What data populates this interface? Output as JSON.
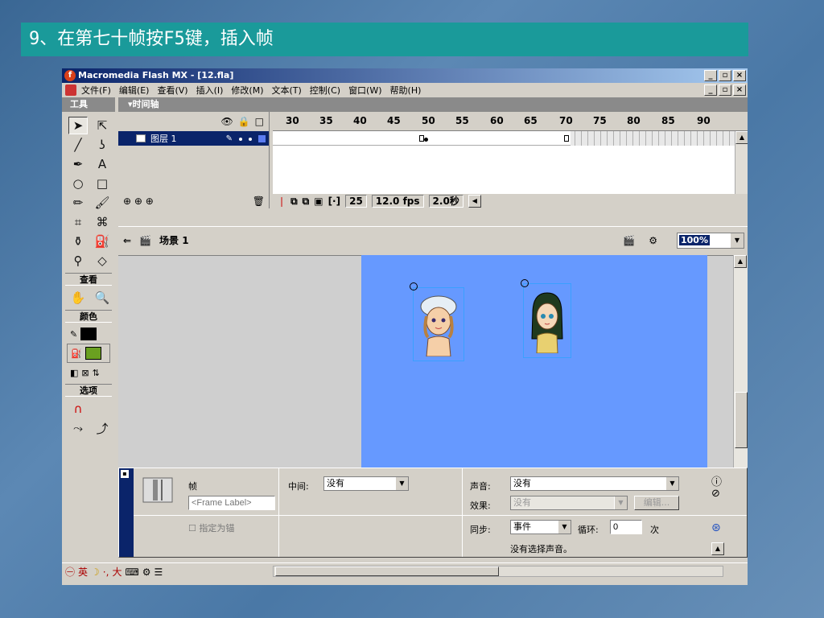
{
  "slide": {
    "title": "9、在第七十帧按F5键，插入帧"
  },
  "window": {
    "title": "Macromedia Flash MX - [12.fla]",
    "logo": "f"
  },
  "menu": [
    "文件(F)",
    "编辑(E)",
    "查看(V)",
    "插入(I)",
    "修改(M)",
    "文本(T)",
    "控制(C)",
    "窗口(W)",
    "帮助(H)"
  ],
  "tools": {
    "title": "工具",
    "view_section": "查看",
    "color_section": "颜色",
    "options_section": "选项",
    "stroke_color": "#000000",
    "fill_color": "#6aa020"
  },
  "timeline": {
    "title": "▾时间轴",
    "layer_name": "图层 1",
    "ruler": [
      "30",
      "35",
      "40",
      "45",
      "50",
      "55",
      "60",
      "65",
      "70",
      "75",
      "80",
      "85",
      "90"
    ],
    "current_frame": "25",
    "fps": "12.0 fps",
    "elapsed": "2.0秒"
  },
  "editbar": {
    "scene": "场景 1",
    "zoom": "100%"
  },
  "props": {
    "frame_title": "帧",
    "frame_label_placeholder": "<Frame Label>",
    "anchor_label": "指定为锚",
    "tween_label": "中间:",
    "tween_value": "没有",
    "sound_label": "声音:",
    "sound_value": "没有",
    "effect_label": "效果:",
    "effect_value": "没有",
    "edit_button": "编辑...",
    "sync_label": "同步:",
    "sync_value": "事件",
    "loop_label": "循环:",
    "loop_value": "0",
    "loop_unit": "次",
    "no_sound": "没有选择声音。"
  },
  "status": {
    "ime": "英",
    "full_width": "大"
  }
}
